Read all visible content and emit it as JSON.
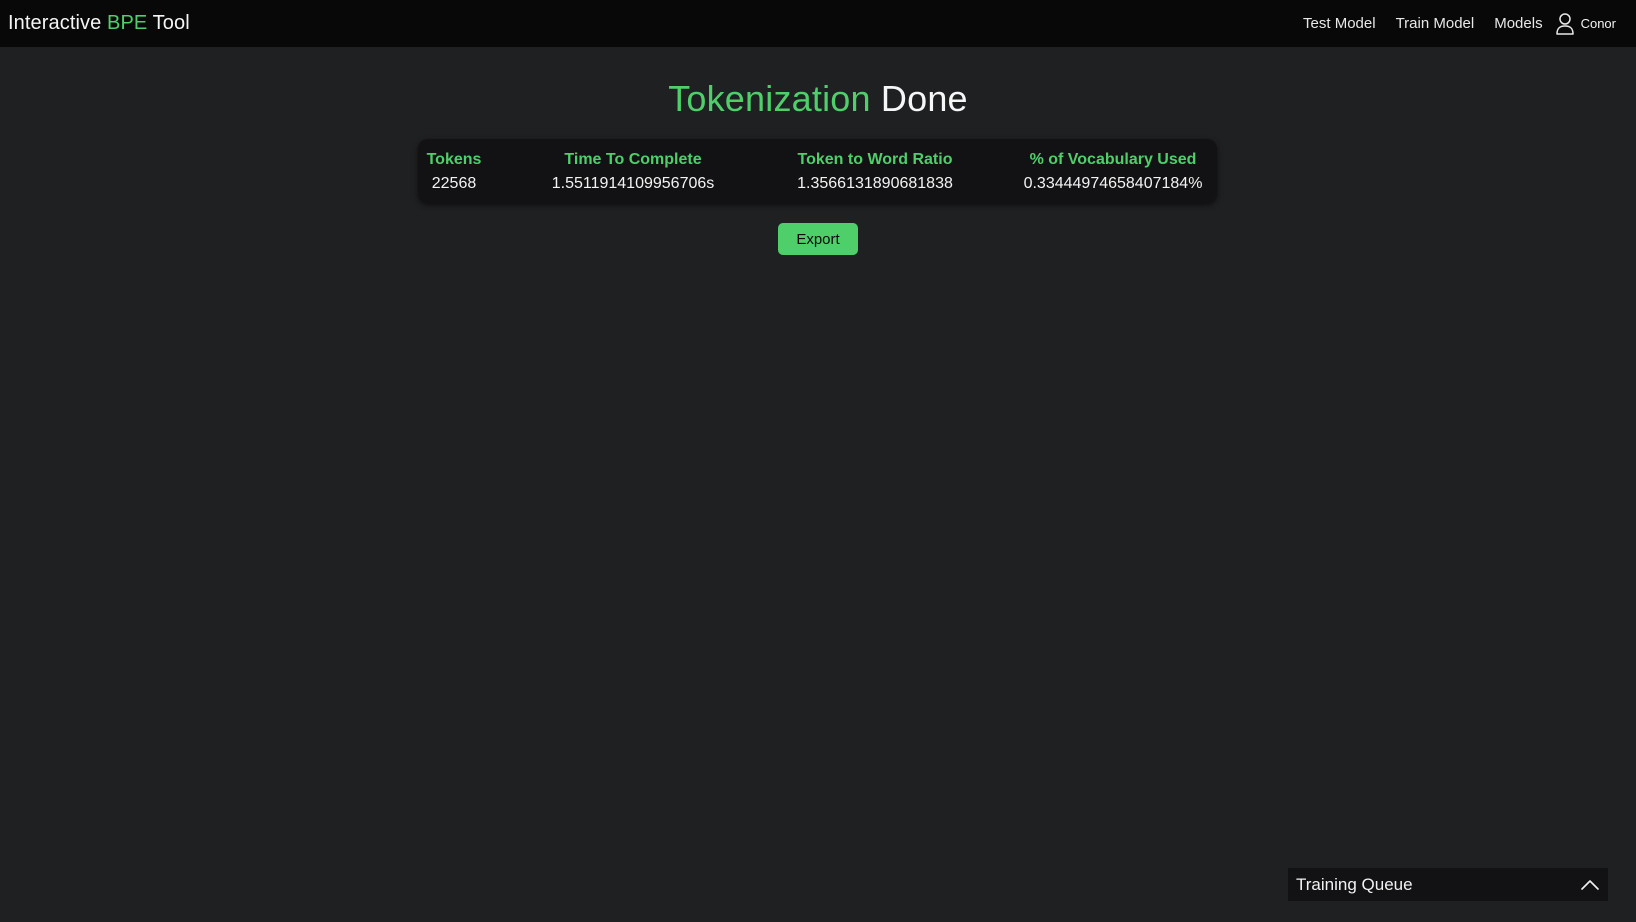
{
  "navbar": {
    "brand": {
      "part1": "Interactive ",
      "part2": "BPE",
      "part3": " Tool"
    },
    "links": [
      "Test Model",
      "Train Model",
      "Models"
    ],
    "user": {
      "name": "Conor",
      "icon": "user-icon"
    }
  },
  "main": {
    "title": {
      "green": "Tokenization",
      "white": " Done"
    },
    "stats": [
      {
        "label": "Tokens",
        "value": "22568"
      },
      {
        "label": "Time To Complete",
        "value": "1.5511914109956706s"
      },
      {
        "label": "Token to Word Ratio",
        "value": "1.3566131890681838"
      },
      {
        "label": "% of Vocabulary Used",
        "value": "0.33444974658407184%"
      }
    ],
    "export_label": "Export"
  },
  "training_queue": {
    "label": "Training Queue",
    "toggle_icon": "chevron-up-icon"
  },
  "colors": {
    "accent": "#4ecf6a",
    "background": "#1f2022",
    "navbar": "#080808",
    "card": "#121214"
  }
}
